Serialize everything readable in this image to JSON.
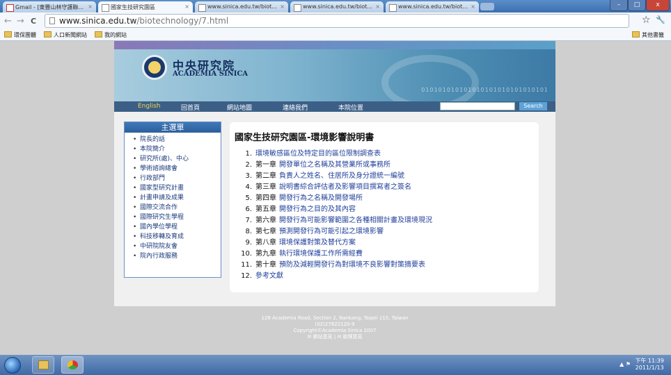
{
  "browser": {
    "tabs": [
      {
        "label": "Gmail - [東豐山林守護聯..."
      },
      {
        "label": "國家生技研究園區"
      },
      {
        "label": "www.sinica.edu.tw/biot..."
      },
      {
        "label": "www.sinica.edu.tw/biot..."
      },
      {
        "label": "www.sinica.edu.tw/biot..."
      }
    ],
    "close_glyph": "×",
    "url_host": "www.sinica.edu.tw",
    "url_path": "/biotechnology/7.html",
    "bookmarks": [
      "環保團體",
      "人口新聞網站",
      "我的網站"
    ],
    "other_bookmarks": "其他書籤",
    "nav_back": "←",
    "nav_forward": "→",
    "nav_reload": "C",
    "star": "☆",
    "wrench": "🔧",
    "window_controls": {
      "minimize": "–",
      "maximize": "□",
      "close": "x"
    }
  },
  "site": {
    "brand_zh": "中央研究院",
    "brand_en": "ACADEMIA SINICA",
    "nav": {
      "english": "English",
      "home": "回首頁",
      "sitemap": "網站地圖",
      "contact": "連絡我們",
      "location": "本院位置",
      "search_button": "Search"
    },
    "sidebar": {
      "title": "主選單",
      "items": [
        "院長的話",
        "本院簡介",
        "研究所(處)、中心",
        "學術諮詢總會",
        "行政部門",
        "國家型研究計畫",
        "計畫申請及成果",
        "國際交流合作",
        "國際研究生學程",
        "國內學位學程",
        "科技移轉及育成",
        "中研院院友會",
        "院內行政服務"
      ]
    },
    "page_title": "國家生技研究園區-環境影響說明書",
    "toc": [
      {
        "num": "1.",
        "chapter": "",
        "text": "環境敏感區位及特定目的區位限制調查表"
      },
      {
        "num": "2.",
        "chapter": "第一章",
        "text": "開發單位之名稱及其營業所或事務所"
      },
      {
        "num": "3.",
        "chapter": "第二章",
        "text": "負責人之姓名、住居所及身分證統一編號"
      },
      {
        "num": "4.",
        "chapter": "第三章",
        "text": "說明書綜合評估者及影響項目撰寫者之簽名"
      },
      {
        "num": "5.",
        "chapter": "第四章",
        "text": "開發行為之名稱及開發場所"
      },
      {
        "num": "6.",
        "chapter": "第五章",
        "text": "開發行為之目的及其內容"
      },
      {
        "num": "7.",
        "chapter": "第六章",
        "text": "開發行為可能影響範圍之各種相關計畫及環境現況"
      },
      {
        "num": "8.",
        "chapter": "第七章",
        "text": "預測開發行為可能引起之環境影響"
      },
      {
        "num": "9.",
        "chapter": "第八章",
        "text": "環境保護對策及替代方案"
      },
      {
        "num": "10.",
        "chapter": "第九章",
        "text": "執行環境保護工作所需經費"
      },
      {
        "num": "11.",
        "chapter": "第十章",
        "text": "預防及減輕開發行為對環境不良影響對策摘要表"
      },
      {
        "num": "12.",
        "chapter": "",
        "text": "參考文獻"
      }
    ],
    "footer": {
      "address": "128 Academia Road, Section 2, Nankang, Taipei 115, Taiwan",
      "phone": "(02)27822120-9",
      "copyright": "Copyright©Academia Sinica 2007",
      "links": "✉ 網站意見 | ✉ 助理意見"
    }
  },
  "taskbar": {
    "time": "下午 11:39",
    "date": "2011/1/13",
    "tray": "▲ ⚑"
  }
}
